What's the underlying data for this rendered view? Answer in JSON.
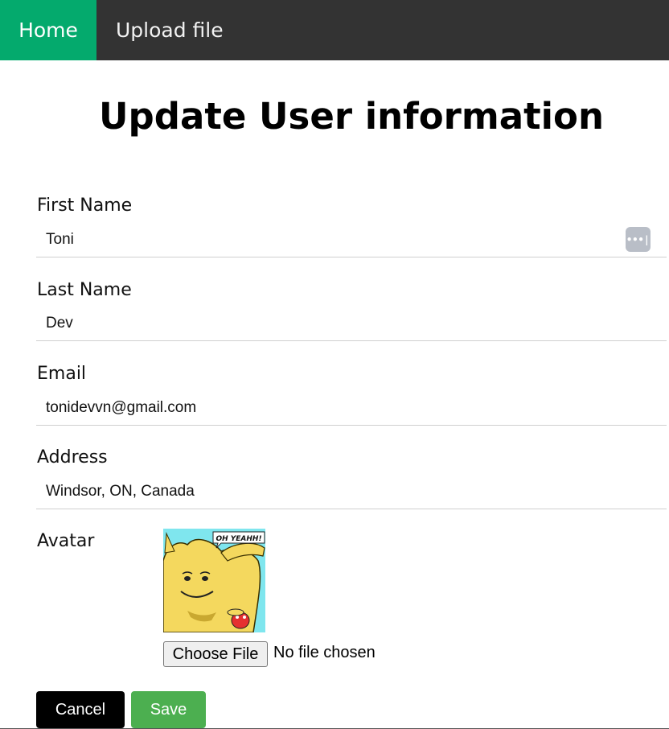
{
  "nav": {
    "home_label": "Home",
    "upload_label": "Upload file",
    "bg_color": "#333333",
    "active_color": "#04AA6D"
  },
  "page_title": "Update User information",
  "form": {
    "first_name": {
      "label": "First Name",
      "value": "Toni"
    },
    "last_name": {
      "label": "Last Name",
      "value": "Dev"
    },
    "email": {
      "label": "Email",
      "value": "tonidevvn@gmail.com"
    },
    "address": {
      "label": "Address",
      "value": "Windsor, ON, Canada"
    },
    "avatar": {
      "label": "Avatar",
      "image_caption": "OH YEAHH!",
      "choose_file_label": "Choose File",
      "file_status": "No file chosen"
    },
    "password_manager_icon": "password-key-icon"
  },
  "buttons": {
    "cancel_label": "Cancel",
    "save_label": "Save",
    "cancel_color": "#000000",
    "save_color": "#4CAF50"
  }
}
